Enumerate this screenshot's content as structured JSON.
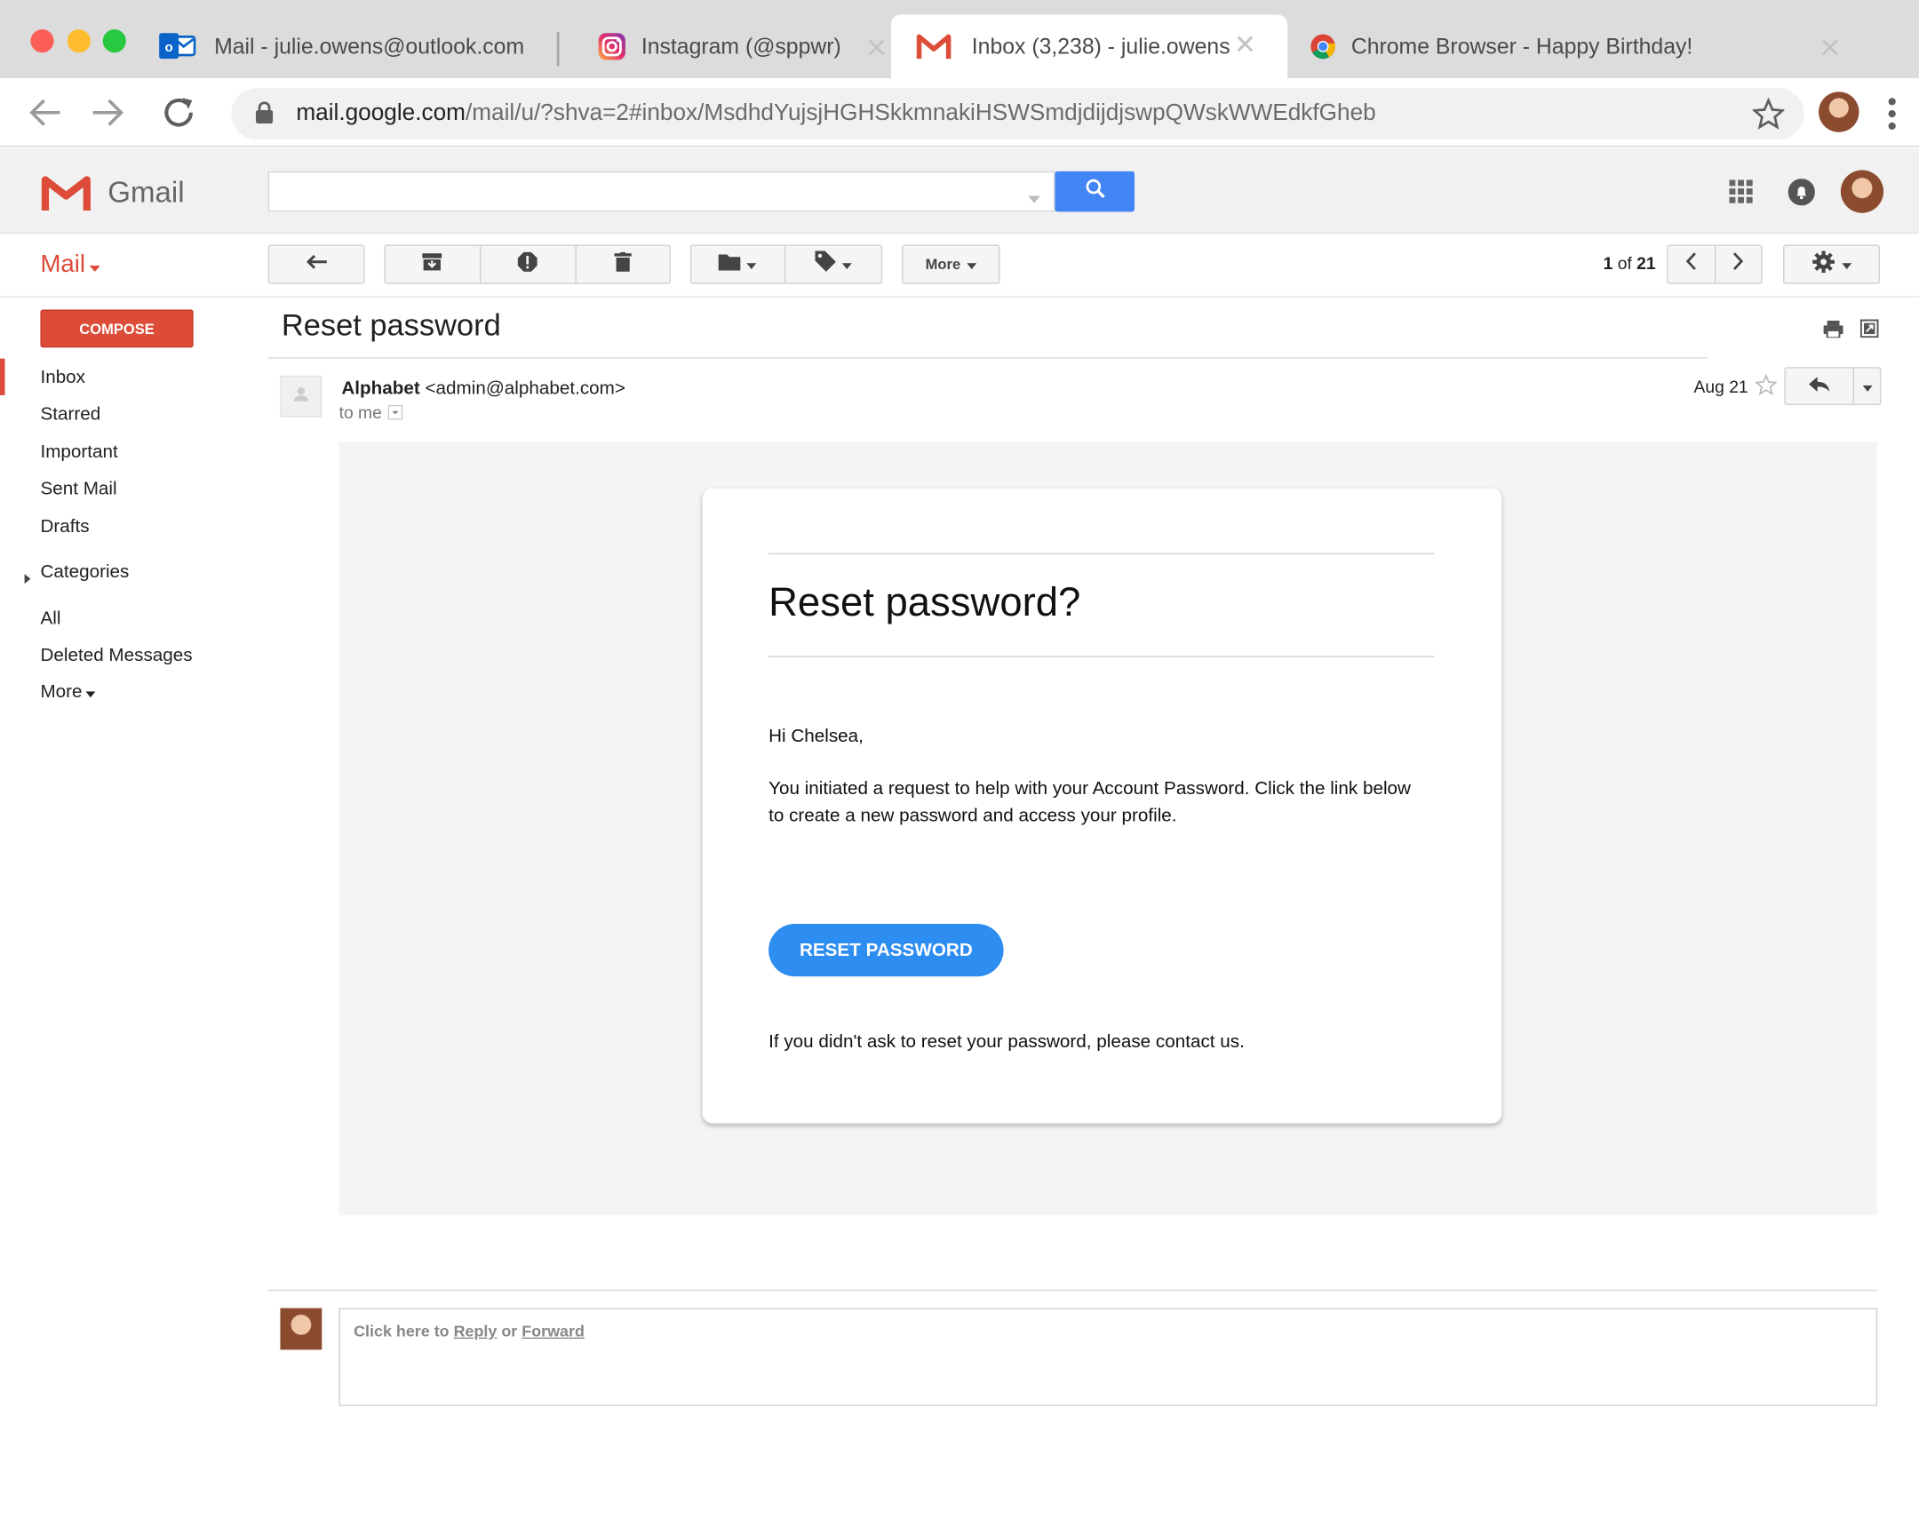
{
  "browser": {
    "tabs": [
      {
        "label": "Mail - julie.owens@outlook.com"
      },
      {
        "label": "Instagram (@sppwr)"
      },
      {
        "label": "Inbox (3,238) - julie.owens"
      },
      {
        "label": "Chrome Browser - Happy Birthday!"
      }
    ],
    "url_host": "mail.google.com",
    "url_path": "/mail/u/?shva=2#inbox/MsdhdYujsjHGHSkkmnakiHSWSmdjdijdjswpQWskWWEdkfGheb"
  },
  "gmail": {
    "logo_text": "Gmail",
    "mail_menu": "Mail",
    "compose": "COMPOSE",
    "nav": {
      "inbox": "Inbox",
      "starred": "Starred",
      "important": "Important",
      "sent": "Sent Mail",
      "drafts": "Drafts",
      "categories": "Categories",
      "all": "All",
      "deleted": "Deleted Messages",
      "more": "More"
    },
    "toolbar": {
      "more": "More",
      "pager_current": "1",
      "pager_of": "of",
      "pager_total": "21"
    },
    "colors": {
      "brand_red": "#dd4b39",
      "accent_blue": "#4285f4",
      "button_blue": "#2d8df0"
    }
  },
  "message": {
    "subject": "Reset password",
    "sender_name": "Alphabet",
    "sender_email": "<admin@alphabet.com>",
    "to": "to me",
    "date": "Aug 21",
    "card": {
      "heading": "Reset password?",
      "greeting": "Hi Chelsea,",
      "body": "You initiated a request to help with your Account Password. Click the link below to create a new password and access your profile.",
      "button": "RESET PASSWORD",
      "footer": "If you didn't ask to reset your password, please contact us."
    }
  },
  "reply_box": {
    "prefix": "Click here to",
    "reply": "Reply",
    "or": "or",
    "forward": "Forward"
  }
}
